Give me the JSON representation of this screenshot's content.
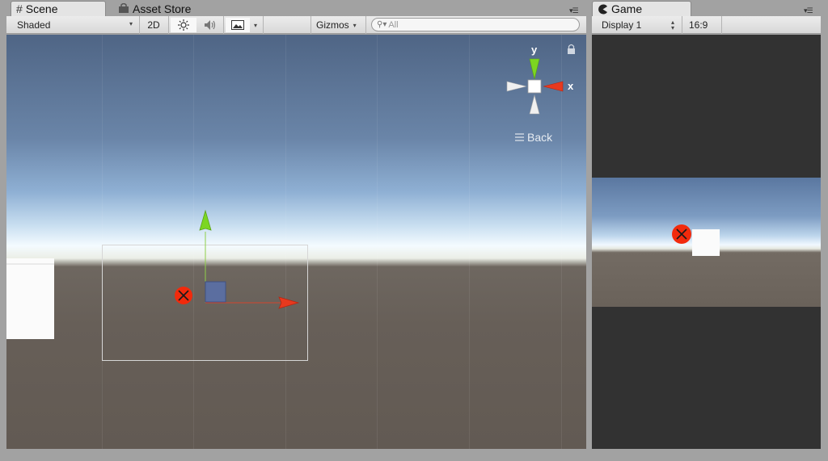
{
  "scene_tabs": {
    "scene_label": "Scene",
    "asset_store_label": "Asset Store"
  },
  "scene_toolbar": {
    "shading_mode": "Shaded",
    "mode_2d": "2D",
    "gizmos_label": "Gizmos",
    "search_placeholder": "All"
  },
  "gizmo": {
    "y_label": "y",
    "x_label": "x",
    "view_label": "Back"
  },
  "game_tab": {
    "label": "Game"
  },
  "game_toolbar": {
    "display": "Display 1",
    "aspect": "16:9"
  },
  "icons": [
    "grid-icon",
    "store-bag-icon",
    "sun-icon",
    "speaker-icon",
    "image-icon",
    "search-icon",
    "lock-icon",
    "pacman-icon",
    "menu-icon"
  ],
  "colors": {
    "x_axis": "#e8391e",
    "y_axis": "#7cd621",
    "marker": "#f22a0c"
  }
}
